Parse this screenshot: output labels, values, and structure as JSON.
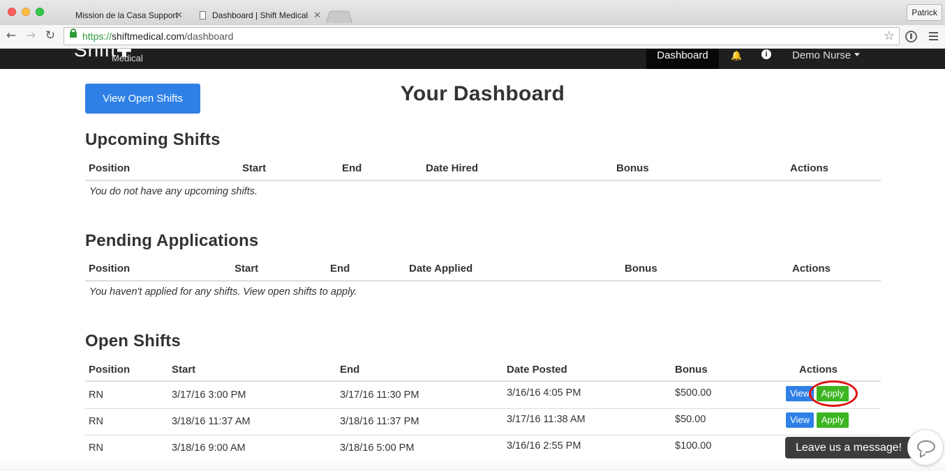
{
  "browser": {
    "tabs": [
      {
        "title": "Mission de la Casa Support"
      },
      {
        "title": "Dashboard | Shift Medical"
      }
    ],
    "profile": "Patrick",
    "url": {
      "scheme": "https://",
      "host": "shiftmedical.com",
      "path": "/dashboard"
    }
  },
  "navbar": {
    "brand": "Shift",
    "brand_sub": "Medical",
    "dashboard_link": "Dashboard",
    "user_menu": "Demo Nurse"
  },
  "page": {
    "view_open_shifts_button": "View Open Shifts",
    "title": "Your Dashboard"
  },
  "upcoming": {
    "title": "Upcoming Shifts",
    "headers": [
      "Position",
      "Start",
      "End",
      "Date Hired",
      "Bonus",
      "Actions"
    ],
    "empty": "You do not have any upcoming shifts."
  },
  "pending": {
    "title": "Pending Applications",
    "headers": [
      "Position",
      "Start",
      "End",
      "Date Applied",
      "Bonus",
      "Actions"
    ],
    "empty": "You haven't applied for any shifts. View open shifts to apply."
  },
  "open": {
    "title": "Open Shifts",
    "headers": [
      "Position",
      "Start",
      "End",
      "Date Posted",
      "Bonus",
      "Actions"
    ],
    "view_label": "View",
    "apply_label": "Apply",
    "rows": [
      {
        "position": "RN",
        "start": "3/17/16 3:00 PM",
        "end": "3/17/16 11:30 PM",
        "posted": "3/16/16 4:05 PM",
        "bonus": "$500.00"
      },
      {
        "position": "RN",
        "start": "3/18/16 11:37 AM",
        "end": "3/18/16 11:37 PM",
        "posted": "3/17/16 11:38 AM",
        "bonus": "$50.00"
      },
      {
        "position": "RN",
        "start": "3/18/16 9:00 AM",
        "end": "3/18/16 5:00 PM",
        "posted": "3/16/16 2:55 PM",
        "bonus": "$100.00"
      }
    ]
  },
  "chat": {
    "label": "Leave us a message!"
  },
  "colors": {
    "primary": "#2f80e6",
    "success": "#3cb521",
    "navbar": "#1f1f1f",
    "highlight": "#e01010"
  }
}
